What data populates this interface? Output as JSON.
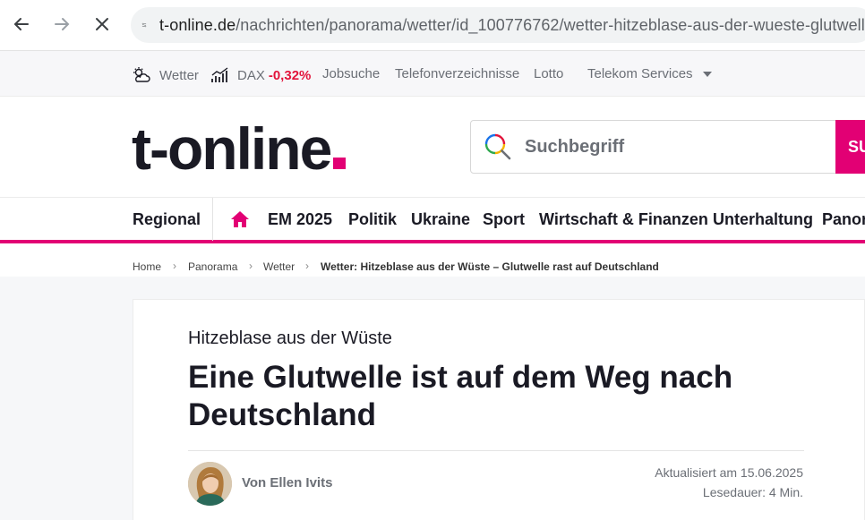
{
  "browser": {
    "url_host": "t-online.de",
    "url_path": "/nachrichten/panorama/wetter/id_100776762/wetter-hitzeblase-aus-der-wueste-glutwelle"
  },
  "service_bar": {
    "weather_label": "Wetter",
    "dax_label": "DAX",
    "dax_value": "-0,32%",
    "links": [
      "Jobsuche",
      "Telefonverzeichnisse",
      "Lotto"
    ],
    "telekom_label": "Telekom Services"
  },
  "header": {
    "logo_text": "t-online",
    "search_placeholder": "Suchbegriff",
    "search_button": "SU"
  },
  "main_nav": {
    "regional": "Regional",
    "items": [
      "EM 2025",
      "Politik",
      "Ukraine",
      "Sport",
      "Wirtschaft & Finanzen",
      "Unterhaltung",
      "Panora"
    ]
  },
  "breadcrumb": [
    "Home",
    "Panorama",
    "Wetter",
    "Wetter: Hitzeblase aus der Wüste – Glutwelle rast auf Deutschland"
  ],
  "article": {
    "kicker": "Hitzeblase aus der Wüste",
    "headline": "Eine Glutwelle ist auf dem Weg nach Deutschland",
    "author": "Von Ellen Ivits",
    "updated": "Aktualisiert am 15.06.2025",
    "reading_time": "Lesedauer: 4 Min."
  },
  "colors": {
    "brand_magenta": "#e20074",
    "dax_negative": "#e2143b"
  }
}
